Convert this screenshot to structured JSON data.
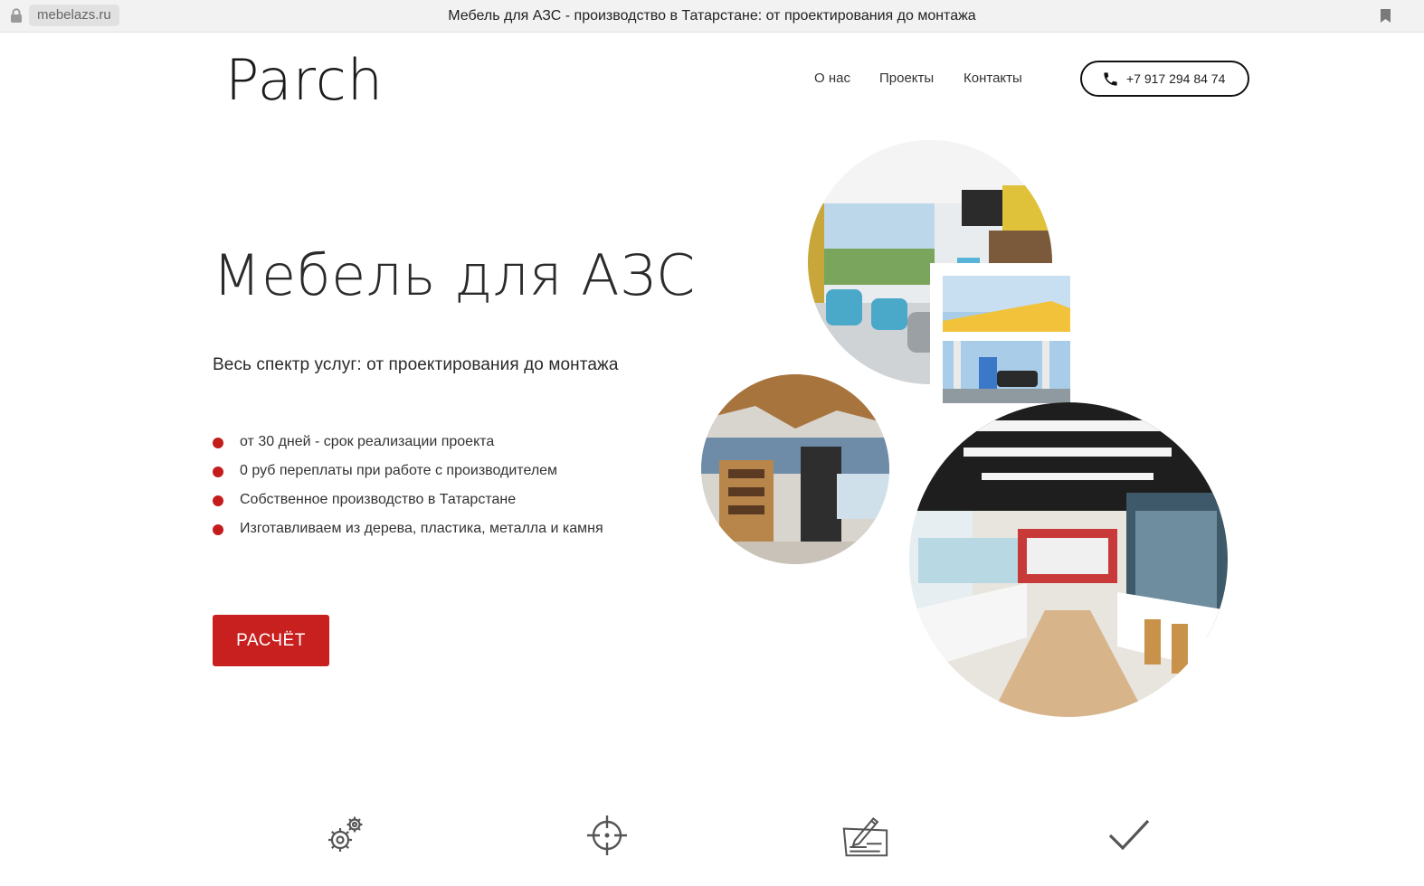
{
  "browser": {
    "url": "mebelazs.ru",
    "title": "Мебель для АЗС - производство в Татарстане: от проектирования до монтажа",
    "icons": [
      "lock-icon",
      "bookmark-icon"
    ]
  },
  "header": {
    "logo": "Parch",
    "nav": [
      {
        "label": "О нас"
      },
      {
        "label": "Проекты"
      },
      {
        "label": "Контакты"
      }
    ],
    "phone": "+7 917 294 84 74",
    "phone_icon": "phone-icon"
  },
  "hero": {
    "title": "Мебель для АЗС",
    "subtitle": "Весь спектр услуг: от проектирования до монтажа",
    "features": [
      "от 30 дней - срок реализации проекта",
      "0 руб переплаты при работе с производителем",
      "Собственное производство в Татарстане",
      "Изготавливаем из дерева, пластика, металла и камня"
    ],
    "cta": "РАСЧЁТ"
  },
  "gallery": {
    "photos": [
      "cafe-interior-photo",
      "gas-station-photo",
      "shop-shelves-photo",
      "store-interior-photo"
    ]
  },
  "bottom_icons": [
    "gears-icon",
    "crosshair-icon",
    "pen-document-icon",
    "checkmark-icon"
  ],
  "colors": {
    "accent": "#c81f1f",
    "text": "#333333",
    "background": "#ffffff"
  }
}
